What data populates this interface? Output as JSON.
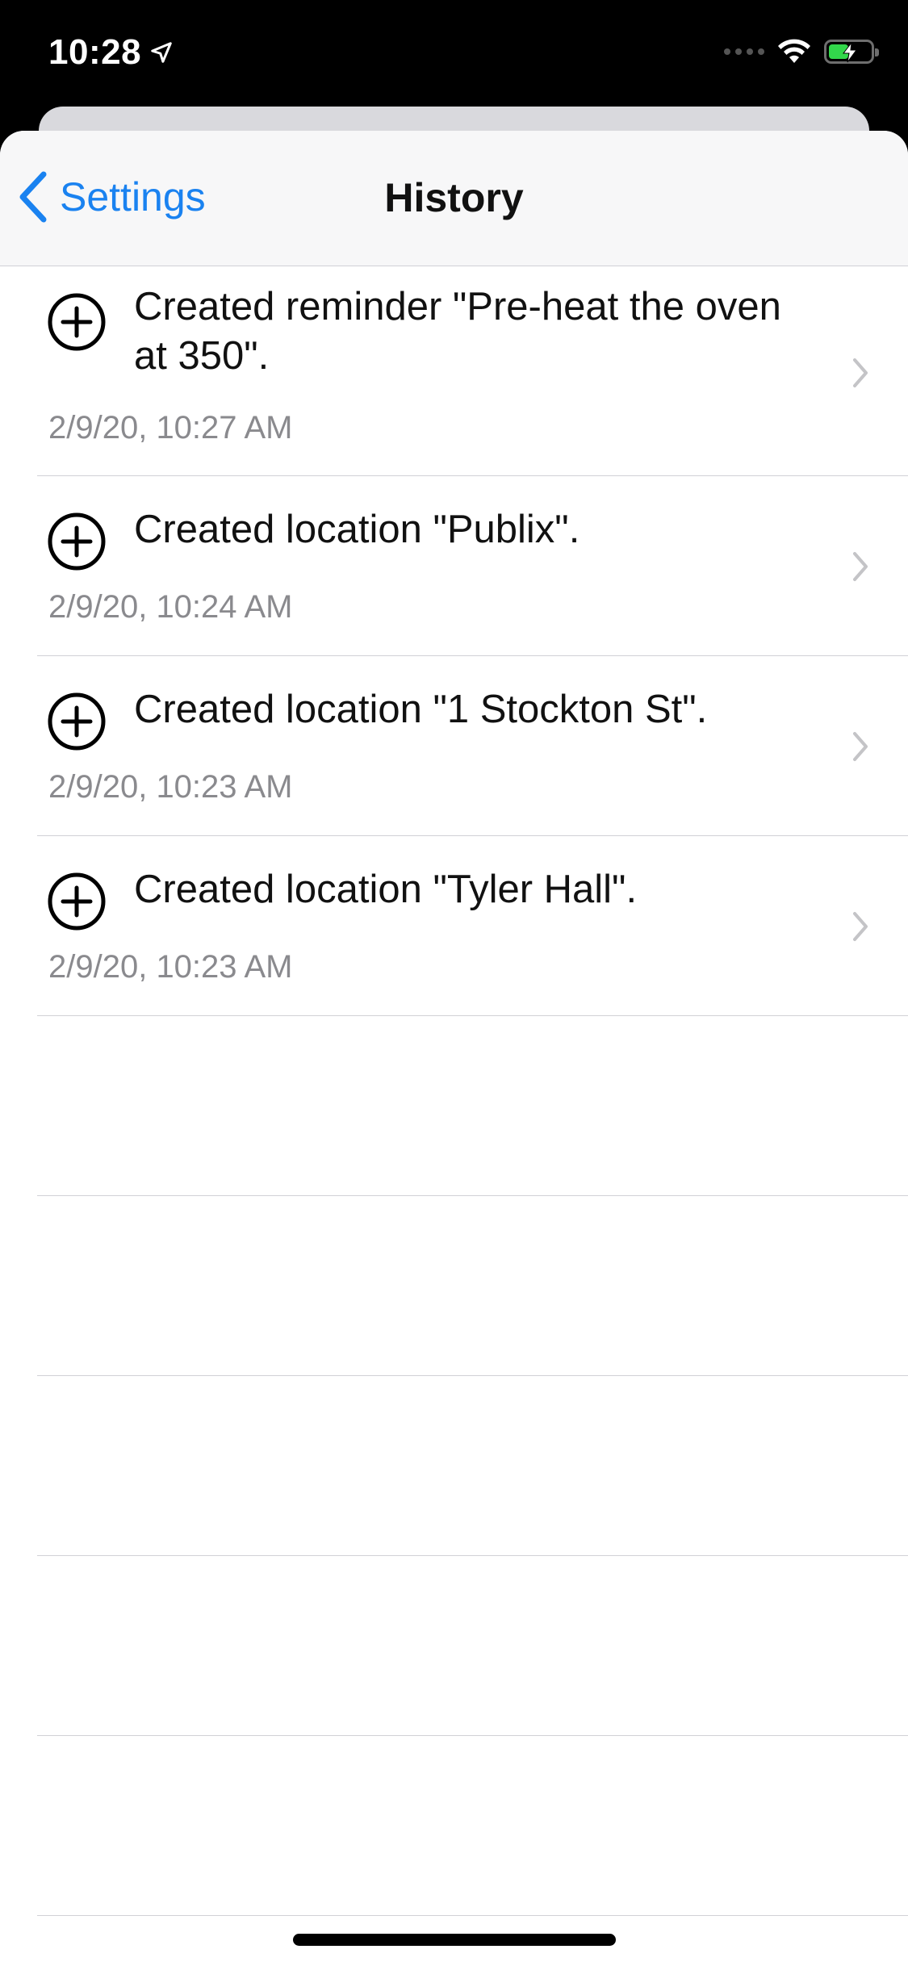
{
  "status_bar": {
    "time": "10:28",
    "location_icon": "location-arrow-icon",
    "wifi_icon": "wifi-icon",
    "battery_icon": "battery-charging-icon",
    "battery_color": "#32d74b"
  },
  "nav": {
    "back_label": "Settings",
    "title": "History",
    "accent_color": "#1a82f0"
  },
  "history": [
    {
      "icon": "plus-circle-icon",
      "title": "Created reminder \"Pre-heat the oven at 350\".",
      "date": "2/9/20, 10:27 AM"
    },
    {
      "icon": "plus-circle-icon",
      "title": "Created location \"Publix\".",
      "date": "2/9/20, 10:24 AM"
    },
    {
      "icon": "plus-circle-icon",
      "title": "Created location \"1 Stockton St\".",
      "date": "2/9/20, 10:23 AM"
    },
    {
      "icon": "plus-circle-icon",
      "title": "Created location \"Tyler Hall\".",
      "date": "2/9/20, 10:23 AM"
    }
  ]
}
